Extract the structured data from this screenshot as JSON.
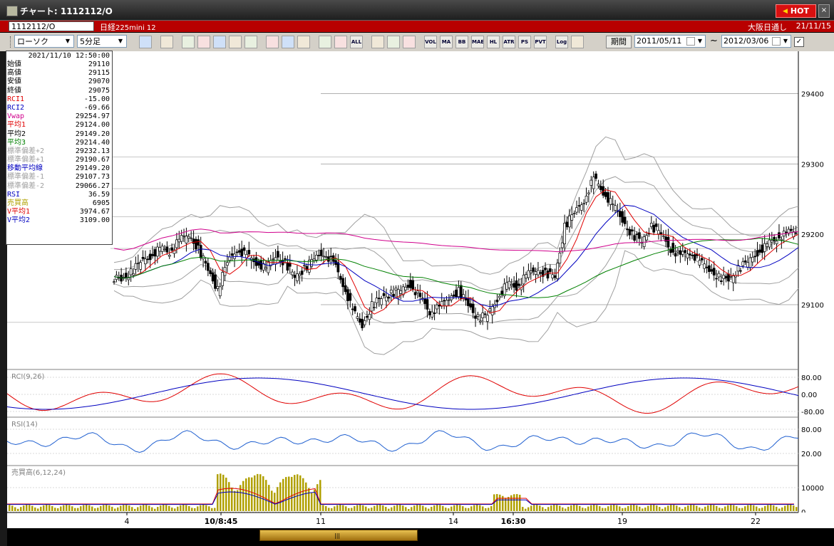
{
  "window": {
    "title": "チャート: 1112112/O",
    "hot_label": "HOT",
    "close_label": "×"
  },
  "symbol_bar": {
    "code": "1112112/O",
    "name": "日経",
    "subname": "225mini 12",
    "market": "大阪日通し",
    "date": "21/11/15"
  },
  "toolbar": {
    "chart_type": "ローソク",
    "timeframe": "5分足",
    "buttons": [
      "zoom",
      "crosshair",
      "candle-a",
      "candle-b",
      "candle-c",
      "candle-d",
      "candle-e",
      "draw-line",
      "cursor",
      "arrow",
      "box-a",
      "box-b",
      "ALL",
      "grid",
      "wrench",
      "palette",
      "VOL",
      "MA",
      "BB",
      "MAE",
      "HL",
      "ATR",
      "PSAR",
      "PVT",
      "Log",
      "export"
    ],
    "period_label": "期間",
    "date_from": "2011/05/11",
    "date_to": "2012/03/06",
    "tilde": "~"
  },
  "info_panel": {
    "datetime": "2021/11/10  12:50:00",
    "rows": [
      {
        "label": "始値",
        "value": "29110",
        "color": "#000000"
      },
      {
        "label": "高値",
        "value": "29115",
        "color": "#000000"
      },
      {
        "label": "安値",
        "value": "29070",
        "color": "#000000"
      },
      {
        "label": "終値",
        "value": "29075",
        "color": "#000000"
      },
      {
        "label": "RCI1",
        "value": "-15.00",
        "color": "#e00000"
      },
      {
        "label": "RCI2",
        "value": "-69.66",
        "color": "#0000c0"
      },
      {
        "label": "Vwap",
        "value": "29254.97",
        "color": "#d0008c"
      },
      {
        "label": "平均1",
        "value": "29124.00",
        "color": "#e00000"
      },
      {
        "label": "平均2",
        "value": "29149.20",
        "color": "#000000"
      },
      {
        "label": "平均3",
        "value": "29214.40",
        "color": "#008000"
      },
      {
        "label": "標準偏差+2",
        "value": "29232.13",
        "color": "#a0a0a0"
      },
      {
        "label": "標準偏差+1",
        "value": "29190.67",
        "color": "#a0a0a0"
      },
      {
        "label": "移動平均線",
        "value": "29149.20",
        "color": "#0000c0"
      },
      {
        "label": "標準偏差-1",
        "value": "29107.73",
        "color": "#a0a0a0"
      },
      {
        "label": "標準偏差-2",
        "value": "29066.27",
        "color": "#a0a0a0"
      },
      {
        "label": "RSI",
        "value": "36.59",
        "color": "#0000c0"
      },
      {
        "label": "売買高",
        "value": "6905",
        "color": "#b0a000"
      },
      {
        "label": "V平均1",
        "value": "3974.67",
        "color": "#e00000"
      },
      {
        "label": "V平均2",
        "value": "3109.00",
        "color": "#0000c0"
      }
    ]
  },
  "chart_data": {
    "type": "candlestick",
    "price_axis": {
      "ticks": [
        "29400",
        "29300",
        "29200",
        "29100"
      ],
      "range": [
        29010,
        29440
      ]
    },
    "date_axis": {
      "ticks": [
        "4",
        "10/8:45",
        "11",
        "14",
        "16:30",
        "19",
        "22"
      ]
    },
    "close_path": [
      29140,
      29135,
      29145,
      29160,
      29170,
      29180,
      29175,
      29190,
      29200,
      29180,
      29150,
      29120,
      29160,
      29180,
      29170,
      29160,
      29150,
      29170,
      29160,
      29140,
      29150,
      29165,
      29175,
      29160,
      29130,
      29090,
      29070,
      29100,
      29110,
      29115,
      29120,
      29130,
      29110,
      29090,
      29095,
      29110,
      29120,
      29100,
      29080,
      29085,
      29110,
      29130,
      29125,
      29140,
      29150,
      29145,
      29140,
      29210,
      29230,
      29250,
      29280,
      29260,
      29240,
      29220,
      29200,
      29190,
      29210,
      29200,
      29180,
      29170,
      29175,
      29160,
      29150,
      29140,
      29135,
      29150,
      29160,
      29175,
      29185,
      29195,
      29200,
      29205
    ],
    "bands": {
      "upper_ref": 29310,
      "lower_ref": 29075
    },
    "indicators": [
      {
        "name": "RCI",
        "label": "RCI(9,26)",
        "ticks": [
          "80.00",
          "0.00",
          "-80.00"
        ]
      },
      {
        "name": "RSI",
        "label": "RSI(14)",
        "ticks": [
          "80.00",
          "20.00"
        ]
      },
      {
        "name": "Volume",
        "label": "売買高(6,12,24)",
        "ticks": [
          "10000",
          "0"
        ]
      }
    ],
    "colors": {
      "candle_up": "#ffffff",
      "candle_down": "#000000",
      "ma_red": "#e00000",
      "ma_blue": "#0000c0",
      "ma_green": "#008000",
      "vwap": "#d0008c",
      "bands": "#a0a0a0",
      "volume": "#b0a000"
    }
  }
}
